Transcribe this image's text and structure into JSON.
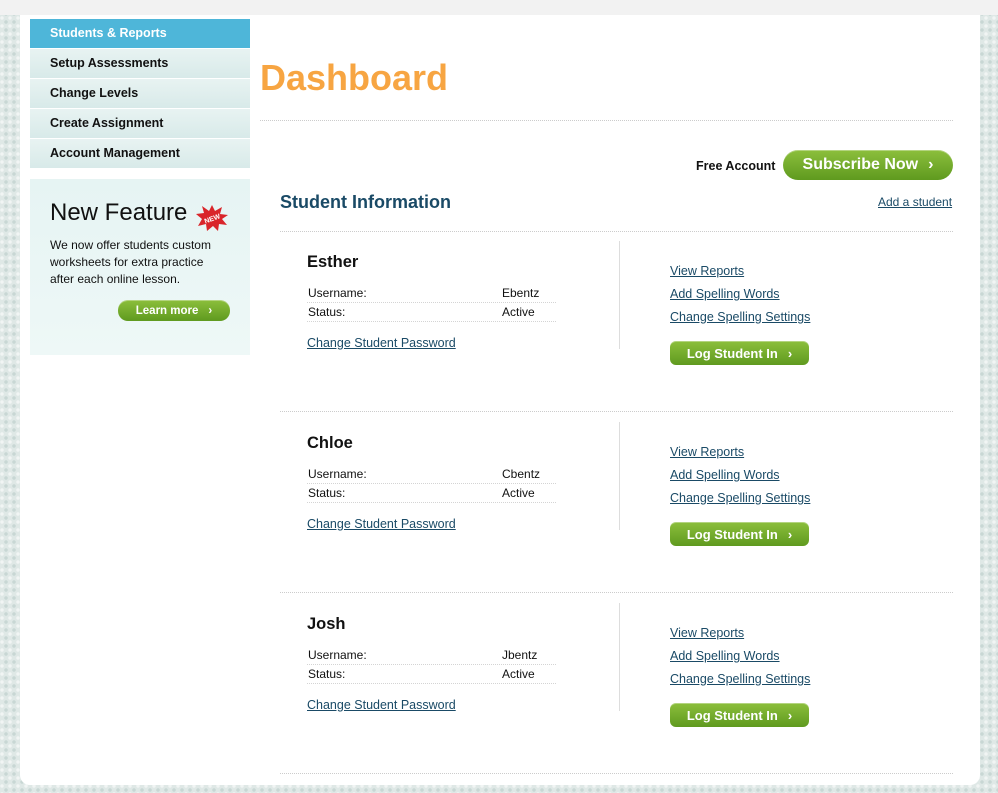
{
  "sidebar": {
    "items": [
      {
        "label": "Students & Reports",
        "active": true
      },
      {
        "label": "Setup Assessments"
      },
      {
        "label": "Change Levels"
      },
      {
        "label": "Create Assignment"
      },
      {
        "label": "Account Management"
      }
    ]
  },
  "promo": {
    "title": "New Feature",
    "badge": "NEW",
    "text": "We now offer students custom worksheets for extra practice after each online lesson.",
    "button": "Learn more"
  },
  "header": {
    "title": "Dashboard",
    "account_type": "Free Account",
    "subscribe_label": "Subscribe Now"
  },
  "students_section": {
    "title": "Student Information",
    "add_link": "Add a student",
    "username_label": "Username:",
    "status_label": "Status:",
    "password_link": "Change Student Password",
    "reports_link": "View Reports",
    "spelling_words_link": "Add Spelling Words",
    "spelling_settings_link": "Change Spelling Settings",
    "login_label": "Log Student In"
  },
  "students": [
    {
      "name": "Esther",
      "username": "Ebentz",
      "status": "Active"
    },
    {
      "name": "Chloe",
      "username": "Cbentz",
      "status": "Active"
    },
    {
      "name": "Josh",
      "username": "Jbentz",
      "status": "Active"
    }
  ],
  "colors": {
    "title_orange": "#f7a542",
    "nav_active": "#4eb6d9",
    "button_green": "#6fa92a",
    "link_blue": "#1a4a66"
  }
}
